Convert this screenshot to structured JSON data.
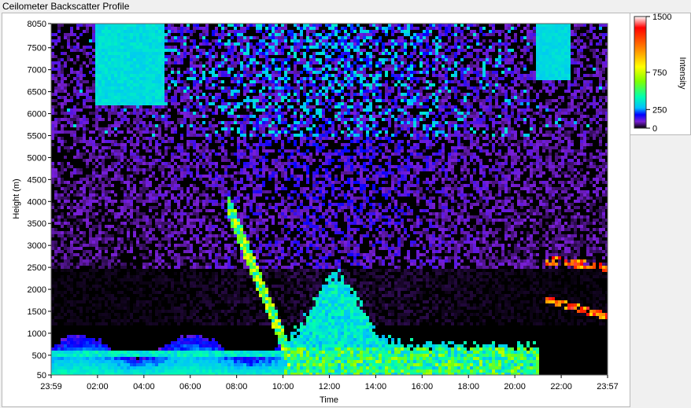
{
  "window": {
    "title": "Ceilometer Backscatter Profile"
  },
  "chart_data": {
    "type": "heatmap",
    "title": "Ceilometer Backscatter Profile",
    "xlabel": "Time",
    "ylabel": "Height (m)",
    "x_ticks": [
      "23:59",
      "02:00",
      "04:00",
      "06:00",
      "08:00",
      "10:00",
      "12:00",
      "14:00",
      "16:00",
      "18:00",
      "20:00",
      "22:00",
      "23:57"
    ],
    "y_ticks": [
      50,
      500,
      1000,
      1500,
      2000,
      2500,
      3000,
      3500,
      4000,
      4500,
      5000,
      5500,
      6000,
      6500,
      7000,
      7500,
      8050
    ],
    "ylim": [
      50,
      8050
    ],
    "xlim_hours": [
      -0.0167,
      23.95
    ],
    "colorbar": {
      "label": "Intensity",
      "ticks": [
        0,
        250,
        750,
        1500
      ],
      "range": [
        0,
        1500
      ],
      "colors": [
        "#000000",
        "#7a1fd6",
        "#0000ff",
        "#00bfff",
        "#00ffb0",
        "#7fff00",
        "#ffff00",
        "#ff8000",
        "#ff0000",
        "#ffffff"
      ]
    },
    "features": [
      {
        "name": "surface-layer",
        "time_start": 0,
        "time_end": 10,
        "height_top": 1000,
        "intensity": 250
      },
      {
        "name": "residual-layer",
        "time_start": 8,
        "time_end": 10,
        "height_top": 3500,
        "intensity": 600
      },
      {
        "name": "convective-boundary-layer",
        "time_start": 10,
        "time_end": 21,
        "height_top": 2300,
        "intensity": 400
      },
      {
        "name": "night-cloud-layer",
        "time_start": 21.5,
        "time_end": 23.95,
        "height_top": 2800,
        "intensity": 1200
      }
    ]
  }
}
